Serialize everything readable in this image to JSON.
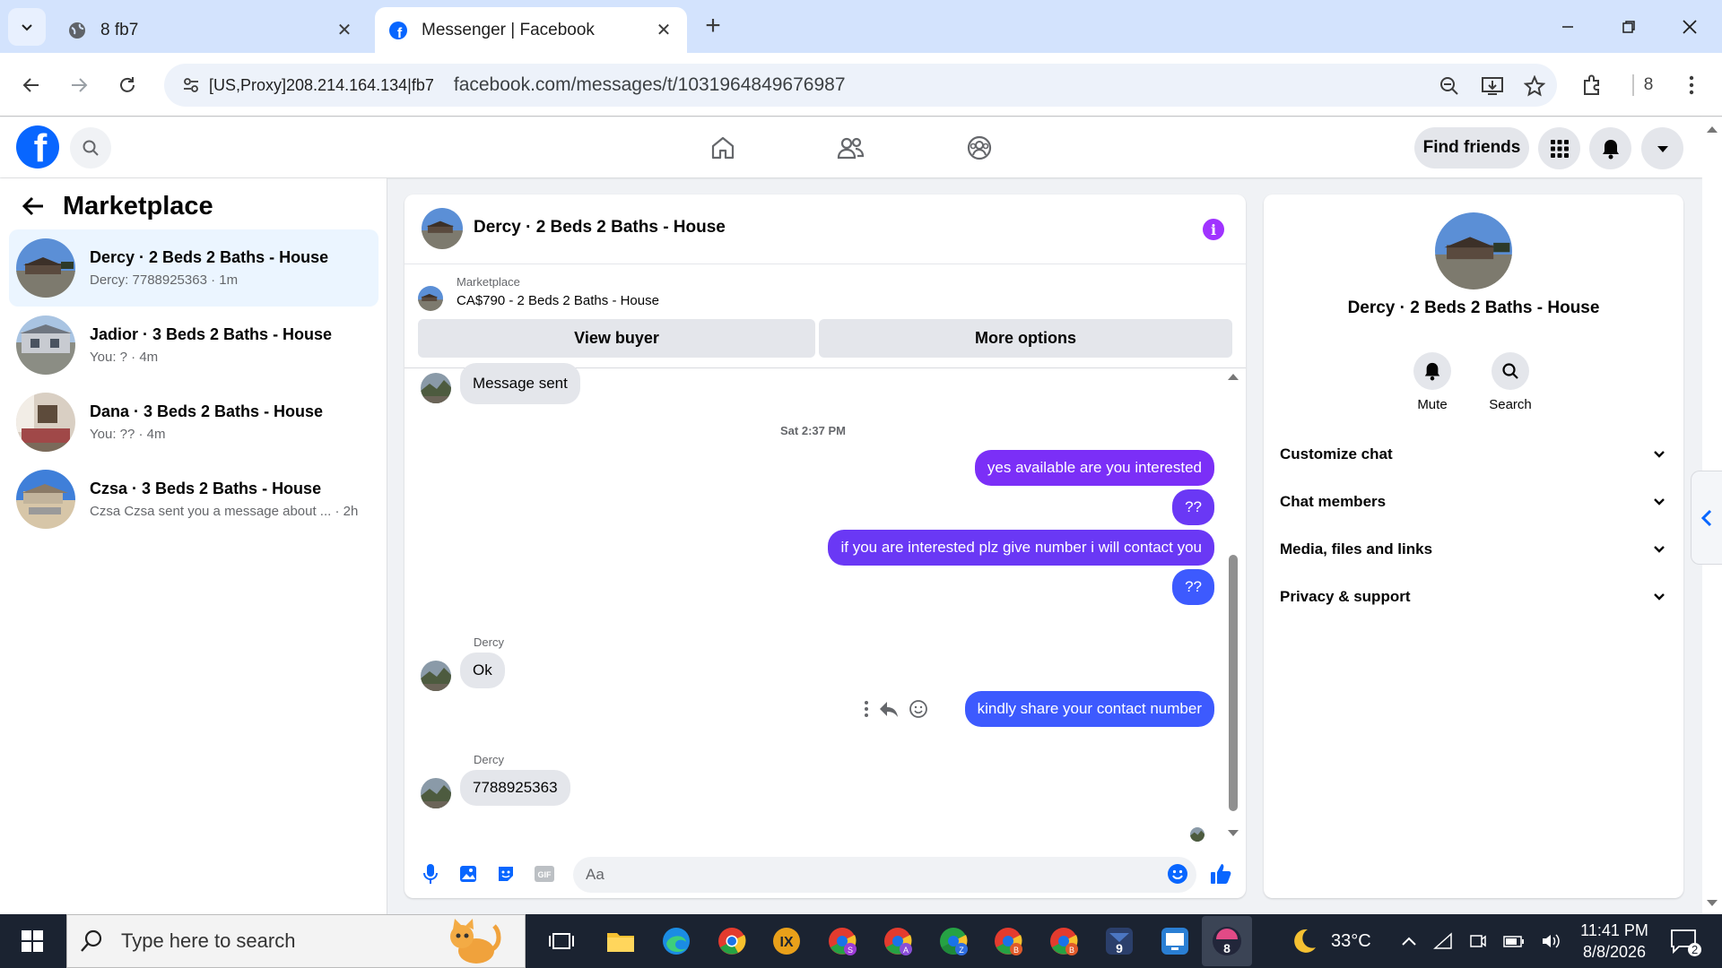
{
  "browser": {
    "tabs": [
      {
        "title": "8 fb7",
        "active": false
      },
      {
        "title": "Messenger | Facebook",
        "active": true
      }
    ],
    "omnibox": {
      "proxy_label": "[US,Proxy]208.214.164.134|fb7",
      "url": "facebook.com/messages/t/1031964849676987"
    },
    "profile_badge": "8"
  },
  "header": {
    "find_friends_label": "Find friends"
  },
  "left_panel": {
    "title": "Marketplace",
    "conversations": [
      {
        "name": "Dercy · 2 Beds 2 Baths - House",
        "preview": "Dercy: 7788925363 · 1m",
        "selected": true
      },
      {
        "name": "Jadior · 3 Beds 2 Baths - House",
        "preview": "You: ? · 4m",
        "selected": false
      },
      {
        "name": "Dana · 3 Beds 2 Baths - House",
        "preview": "You: ?? · 4m",
        "selected": false
      },
      {
        "name": "Czsa · 3 Beds 2 Baths - House",
        "preview": "Czsa Czsa sent you a message about ... · 2h",
        "selected": false
      }
    ]
  },
  "chat": {
    "title": "Dercy · 2 Beds 2 Baths - House",
    "marketplace_label": "Marketplace",
    "listing": "CA$790 - 2 Beds 2 Baths - House",
    "view_buyer_label": "View buyer",
    "more_options_label": "More options",
    "messages": {
      "first_incoming": "Message sent",
      "timestamp": "Sat 2:37 PM",
      "out1": "yes available are you interested",
      "out2": "??",
      "out3": "if you are interested plz give number i will contact you",
      "out4": "??",
      "sender1": "Dercy",
      "in1": "Ok",
      "out5": "kindly share your contact number",
      "sender2": "Dercy",
      "in2": "7788925363"
    },
    "composer_placeholder": "Aa"
  },
  "info_panel": {
    "title": "Dercy · 2 Beds 2 Baths - House",
    "mute_label": "Mute",
    "search_label": "Search",
    "sections": [
      "Customize chat",
      "Chat members",
      "Media, files and links",
      "Privacy & support"
    ]
  },
  "taskbar": {
    "search_placeholder": "Type here to search",
    "weather": "33°C",
    "time": "11:41 PM",
    "date": "8/8/2026",
    "notification_count": "2"
  },
  "colors": {
    "facebook_blue": "#0866ff",
    "outgoing_bubble": "#7b2ff7",
    "selected_conversation": "#ebf5ff"
  }
}
